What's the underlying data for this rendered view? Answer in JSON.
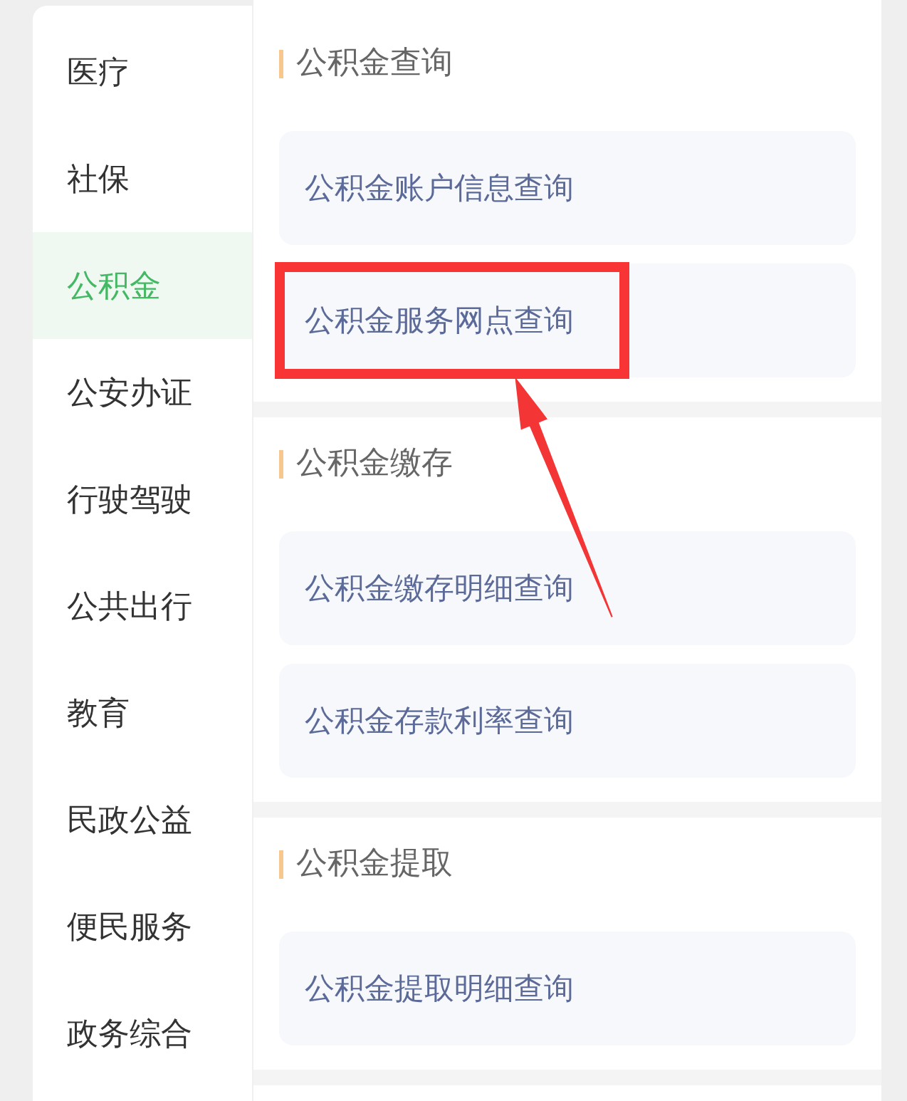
{
  "sidebar": {
    "items": [
      {
        "label": "医疗",
        "selected": false
      },
      {
        "label": "社保",
        "selected": false
      },
      {
        "label": "公积金",
        "selected": true
      },
      {
        "label": "公安办证",
        "selected": false
      },
      {
        "label": "行驶驾驶",
        "selected": false
      },
      {
        "label": "公共出行",
        "selected": false
      },
      {
        "label": "教育",
        "selected": false
      },
      {
        "label": "民政公益",
        "selected": false
      },
      {
        "label": "便民服务",
        "selected": false
      },
      {
        "label": "政务综合",
        "selected": false
      }
    ]
  },
  "sections": [
    {
      "title": "公积金查询",
      "items": [
        {
          "label": "公积金账户信息查询",
          "highlighted": false
        },
        {
          "label": "公积金服务网点查询",
          "highlighted": true
        }
      ]
    },
    {
      "title": "公积金缴存",
      "items": [
        {
          "label": "公积金缴存明细查询",
          "highlighted": false
        },
        {
          "label": "公积金存款利率查询",
          "highlighted": false
        }
      ]
    },
    {
      "title": "公积金提取",
      "items": [
        {
          "label": "公积金提取明细查询",
          "highlighted": false
        }
      ]
    }
  ]
}
